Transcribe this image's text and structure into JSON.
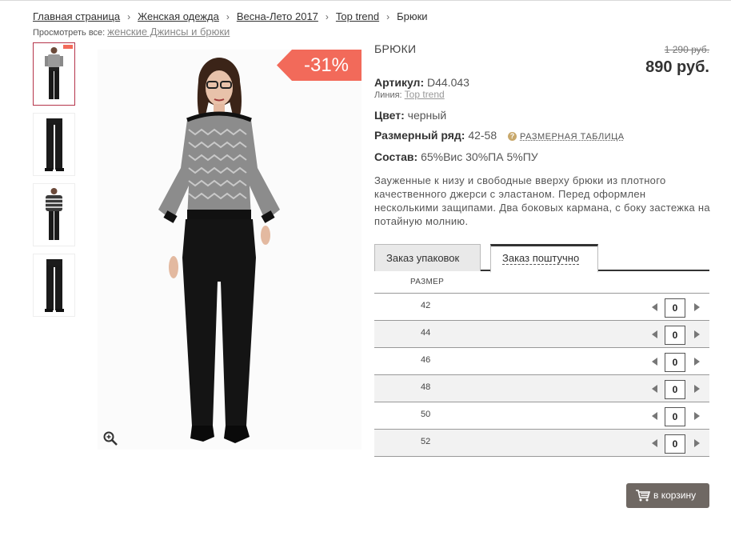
{
  "breadcrumb": {
    "items": [
      "Главная страница",
      "Женская одежда",
      "Весна-Лето 2017",
      "Top trend",
      "Брюки"
    ],
    "sep": "›"
  },
  "viewall": {
    "prefix": "Просмотреть все:",
    "link": "женские Джинсы и брюки"
  },
  "product": {
    "title": "БРЮКИ",
    "old_price": "1 290 руб.",
    "new_price": "890 руб.",
    "discount": "-31%",
    "article_label": "Артикул:",
    "article_value": "D44.043",
    "line_label": "Линия:",
    "line_value": "Top trend",
    "color_label": "Цвет:",
    "color_value": "черный",
    "size_range_label": "Размерный ряд:",
    "size_range_value": "42-58",
    "help_icon": "?",
    "size_table_link": "РАЗМЕРНАЯ ТАБЛИЦА",
    "composition_label": "Состав:",
    "composition_value": "65%Вис 30%ПА 5%ПУ",
    "description": "Зауженные к низу и свободные вверху брюки из плотного качественного джерси с эластаном. Перед оформлен несколькими защипами. Два боковых кармана, с боку застежка на потайную молнию."
  },
  "tabs": [
    {
      "label": "Заказ упаковок"
    },
    {
      "label": "Заказ поштучно"
    }
  ],
  "size_table": {
    "header": "РАЗМЕР",
    "rows": [
      {
        "size": "42",
        "qty": "0"
      },
      {
        "size": "44",
        "qty": "0"
      },
      {
        "size": "46",
        "qty": "0"
      },
      {
        "size": "48",
        "qty": "0"
      },
      {
        "size": "50",
        "qty": "0"
      },
      {
        "size": "52",
        "qty": "0"
      }
    ]
  },
  "cart_button": {
    "label": "в корзину",
    "icon": "cart-icon"
  },
  "colors": {
    "accent_red": "#f26a5a",
    "cart_btn": "#6f6863",
    "active_thumb_border": "#b5344a"
  }
}
